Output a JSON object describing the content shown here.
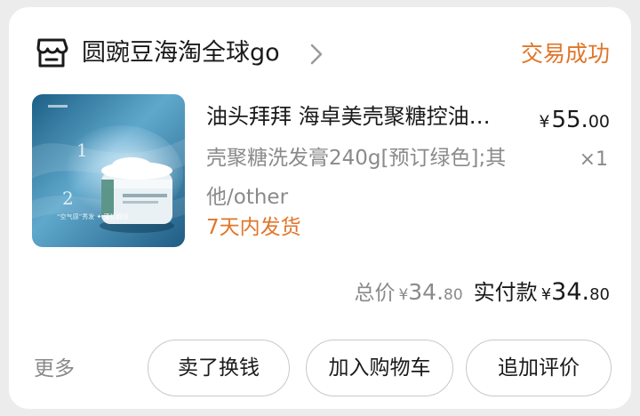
{
  "store": {
    "name": "圆豌豆海淘全球go",
    "icon": "store-icon",
    "chevron_icon": "chevron-right-icon"
  },
  "order": {
    "status": "交易成功"
  },
  "product": {
    "thumbnail_icon": "product-thumbnail",
    "thumbnail_text": {
      "step1": "1",
      "step2": "2",
      "caption": "“空气感”秀发 ✦ 蓬松翻倍"
    },
    "title": "油头拜拜 海卓美壳聚糖控油…",
    "price_currency": "¥",
    "price_int": "55.",
    "price_dec": "00",
    "sku": "壳聚糖洗发膏240g[预订绿色];其他/other",
    "quantity": "×1",
    "shipping_tag": "7天内发货"
  },
  "totals": {
    "total_label": "总价",
    "total_currency": "¥",
    "total_int": "34.",
    "total_dec": "80",
    "paid_label": "实付款",
    "paid_currency": "¥",
    "paid_int": "34.",
    "paid_dec": "80"
  },
  "actions": {
    "more": "更多",
    "sell": "卖了换钱",
    "add_to_cart": "加入购物车",
    "review": "追加评价"
  },
  "colors": {
    "accent_orange": "#e0762a",
    "text_primary": "#1a1a1a",
    "text_secondary": "#8a8a8a",
    "background": "#ececec"
  }
}
